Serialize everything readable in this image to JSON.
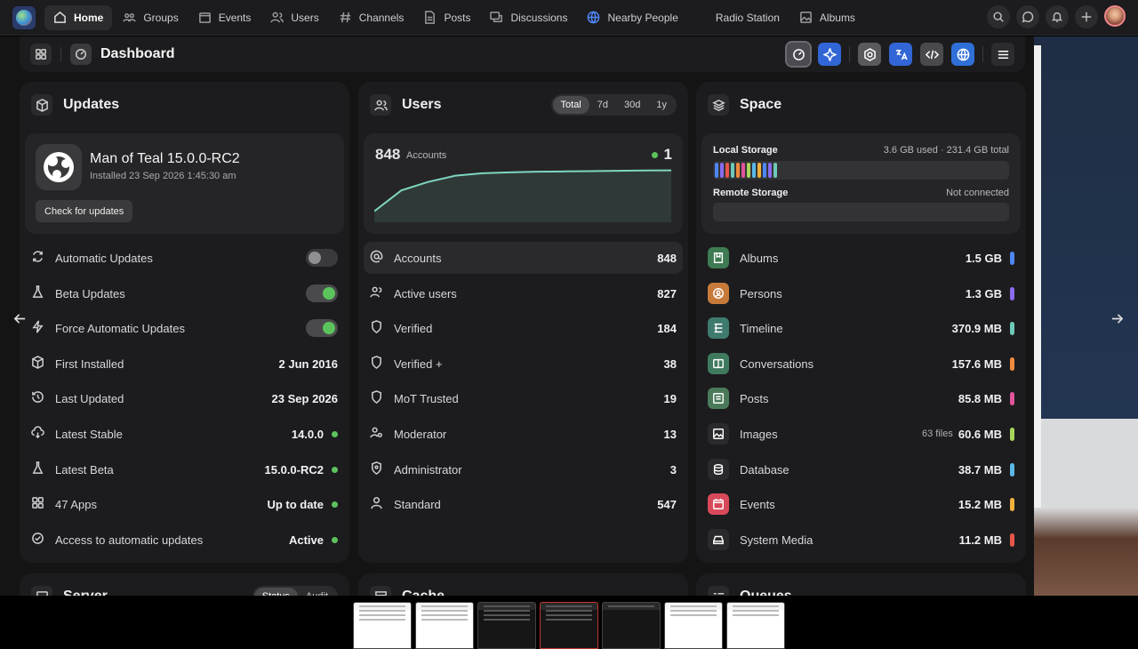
{
  "nav": {
    "items": [
      {
        "label": "Home",
        "icon": "home-icon",
        "active": true
      },
      {
        "label": "Groups",
        "icon": "groups-icon"
      },
      {
        "label": "Events",
        "icon": "calendar-icon"
      },
      {
        "label": "Users",
        "icon": "users-icon"
      },
      {
        "label": "Channels",
        "icon": "hash-icon"
      },
      {
        "label": "Posts",
        "icon": "document-icon"
      },
      {
        "label": "Discussions",
        "icon": "chat-icon"
      },
      {
        "label": "Nearby People",
        "icon": "globe-icon"
      },
      {
        "label": "Radio Station",
        "icon": "radio-icon"
      },
      {
        "label": "Albums",
        "icon": "image-icon"
      }
    ]
  },
  "header": {
    "title": "Dashboard"
  },
  "updates": {
    "title": "Updates",
    "version_title": "Man of Teal 15.0.0-RC2",
    "installed": "Installed 23 Sep 2026 1:45:30 am",
    "check_button": "Check for updates",
    "rows": [
      {
        "label": "Automatic Updates",
        "toggle": false
      },
      {
        "label": "Beta Updates",
        "toggle": true
      },
      {
        "label": "Force Automatic Updates",
        "toggle": true
      },
      {
        "label": "First Installed",
        "value": "2 Jun 2016"
      },
      {
        "label": "Last Updated",
        "value": "23 Sep 2026"
      },
      {
        "label": "Latest Stable",
        "value": "14.0.0",
        "status": "green"
      },
      {
        "label": "Latest Beta",
        "value": "15.0.0-RC2",
        "status": "green"
      },
      {
        "label": "47 Apps",
        "value": "Up to date",
        "status": "green"
      },
      {
        "label": "Access to automatic updates",
        "value": "Active",
        "status": "green"
      }
    ]
  },
  "users": {
    "title": "Users",
    "ranges": [
      "Total",
      "7d",
      "30d",
      "1y"
    ],
    "selected_range": "Total",
    "accounts_count": "848",
    "accounts_label": "Accounts",
    "online_count": "1",
    "rows": [
      {
        "label": "Accounts",
        "value": "848"
      },
      {
        "label": "Active users",
        "value": "827"
      },
      {
        "label": "Verified",
        "value": "184"
      },
      {
        "label": "Verified +",
        "value": "38"
      },
      {
        "label": "MoT Trusted",
        "value": "19"
      },
      {
        "label": "Moderator",
        "value": "13"
      },
      {
        "label": "Administrator",
        "value": "3"
      },
      {
        "label": "Standard",
        "value": "547"
      }
    ]
  },
  "space": {
    "title": "Space",
    "local_label": "Local Storage",
    "local_value": "3.6 GB used · 231.4 GB total",
    "remote_label": "Remote Storage",
    "remote_value": "Not connected",
    "rows": [
      {
        "label": "Albums",
        "value": "1.5 GB",
        "color": "#4f86f7",
        "icon_bg": "#3e7a52"
      },
      {
        "label": "Persons",
        "value": "1.3 GB",
        "color": "#8a6cf0",
        "icon_bg": "#c77a3a"
      },
      {
        "label": "Timeline",
        "value": "370.9 MB",
        "color": "#6ec9b8",
        "icon_bg": "#3f7a6e"
      },
      {
        "label": "Conversations",
        "value": "157.6 MB",
        "color": "#f08a3c",
        "icon_bg": "#3f7a5e"
      },
      {
        "label": "Posts",
        "value": "85.8 MB",
        "color": "#e0559a",
        "icon_bg": "#4a7a5a"
      },
      {
        "label": "Images",
        "value": "60.6 MB",
        "extra": "63 files",
        "color": "#a7d65a",
        "icon_bg": "#2a2a2c"
      },
      {
        "label": "Database",
        "value": "38.7 MB",
        "color": "#5ab8e8",
        "icon_bg": "#2a2a2c"
      },
      {
        "label": "Events",
        "value": "15.2 MB",
        "color": "#f0b03c",
        "icon_bg": "#d84a5a"
      },
      {
        "label": "System Media",
        "value": "11.2 MB",
        "color": "#e8564a",
        "icon_bg": "#2a2a2c"
      }
    ]
  },
  "bottom": {
    "server": "Server",
    "server_tabs": [
      "Status",
      "Audit"
    ],
    "cache": "Cache",
    "queues": "Queues"
  },
  "chart_data": {
    "type": "area",
    "series": [
      {
        "values": [
          180,
          520,
          660,
          760,
          800,
          815,
          825,
          830,
          835,
          840,
          845,
          848
        ]
      }
    ]
  }
}
